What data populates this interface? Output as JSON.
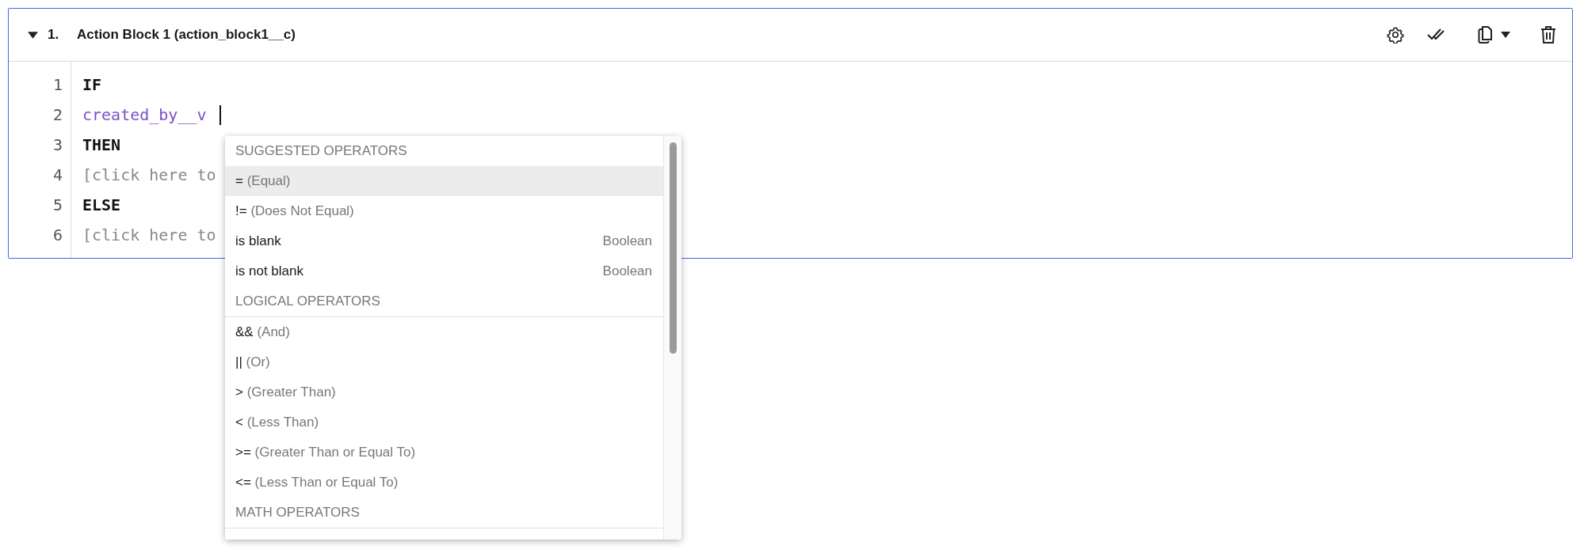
{
  "block": {
    "expanded": true,
    "number": "1.",
    "title": "Action Block 1 (action_block1__c)"
  },
  "code_lines": [
    {
      "number": "1",
      "kind": "keyword",
      "text": "IF",
      "cursor": false
    },
    {
      "number": "2",
      "kind": "field",
      "text": "created_by__v",
      "cursor": true
    },
    {
      "number": "3",
      "kind": "keyword",
      "text": "THEN",
      "cursor": false
    },
    {
      "number": "4",
      "kind": "placeholder",
      "text": "[click here to",
      "cursor": false
    },
    {
      "number": "5",
      "kind": "keyword",
      "text": "ELSE",
      "cursor": false
    },
    {
      "number": "6",
      "kind": "placeholder",
      "text": "[click here to",
      "cursor": false
    }
  ],
  "menu": [
    {
      "kind": "header",
      "text": "SUGGESTED OPERATORS"
    },
    {
      "kind": "option",
      "symbol": "=",
      "description": "(Equal)",
      "selected": true
    },
    {
      "kind": "option",
      "symbol": "!=",
      "description": "(Does Not Equal)",
      "selected": false
    },
    {
      "kind": "option",
      "symbol": "is blank",
      "type": "Boolean",
      "selected": false
    },
    {
      "kind": "option",
      "symbol": "is not blank",
      "type": "Boolean",
      "selected": false
    },
    {
      "kind": "header",
      "text": "LOGICAL OPERATORS"
    },
    {
      "kind": "option",
      "symbol": "&&",
      "description": "(And)",
      "selected": false
    },
    {
      "kind": "option",
      "symbol": "||",
      "description": "(Or)",
      "selected": false
    },
    {
      "kind": "option",
      "symbol": ">",
      "description": "(Greater Than)",
      "selected": false
    },
    {
      "kind": "option",
      "symbol": "<",
      "description": "(Less Than)",
      "selected": false
    },
    {
      "kind": "option",
      "symbol": ">=",
      "description": "(Greater Than or Equal To)",
      "selected": false
    },
    {
      "kind": "option",
      "symbol": "<=",
      "description": "(Less Than or Equal To)",
      "selected": false
    },
    {
      "kind": "header",
      "text": "MATH OPERATORS"
    }
  ]
}
